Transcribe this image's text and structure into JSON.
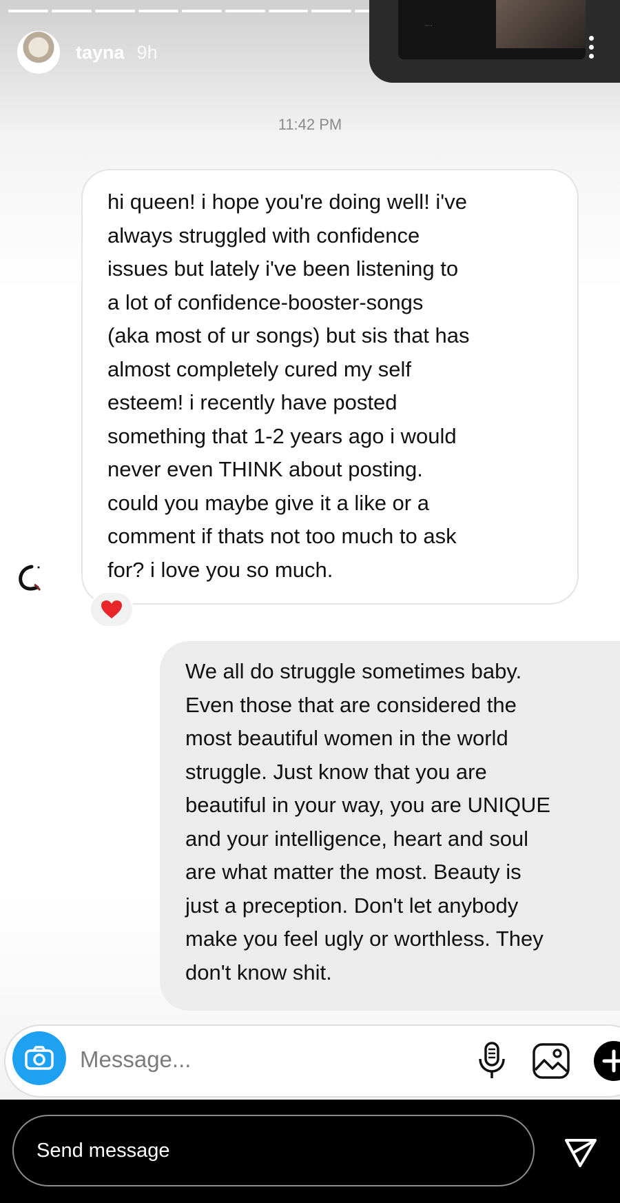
{
  "story": {
    "username": "tayna",
    "time_ago": "9h",
    "progress_segments": 14,
    "progress_done": 9
  },
  "chat": {
    "timestamp": "11:42 PM",
    "received_lines": [
      "hi queen! i hope you're doing well! i've",
      "always struggled with confidence",
      "issues but lately i've been listening to",
      "a lot of confidence-booster-songs",
      "(aka most of ur songs) but sis that has",
      "almost completely cured my self",
      "esteem! i recently have posted",
      "something that 1-2 years ago i would",
      "never even THINK about posting.",
      "could you maybe give it a like or a",
      "comment if thats not too much to ask",
      "for? i love you so much."
    ],
    "reaction": "heart",
    "sent_lines": [
      "We all do struggle sometimes baby.",
      "Even those that are considered the",
      "most beautiful women in the world",
      "struggle. Just know that you are",
      "beautiful in your way, you are UNIQUE",
      "and your intelligence, heart and soul",
      "are what matter the most. Beauty is",
      "just a preception. Don't let anybody",
      "make you feel ugly or worthless. They",
      "don't know shit."
    ]
  },
  "composer": {
    "placeholder": "Message...",
    "icons": [
      "camera-icon",
      "microphone-icon",
      "gallery-icon",
      "add-icon"
    ]
  },
  "reply_bar": {
    "label": "Send message",
    "icon": "send-icon"
  },
  "colors": {
    "camera_blue": "#1ea1f1",
    "heart_red": "#e8262a",
    "sent_bubble": "#ececec",
    "bottom_bar": "#000000"
  }
}
